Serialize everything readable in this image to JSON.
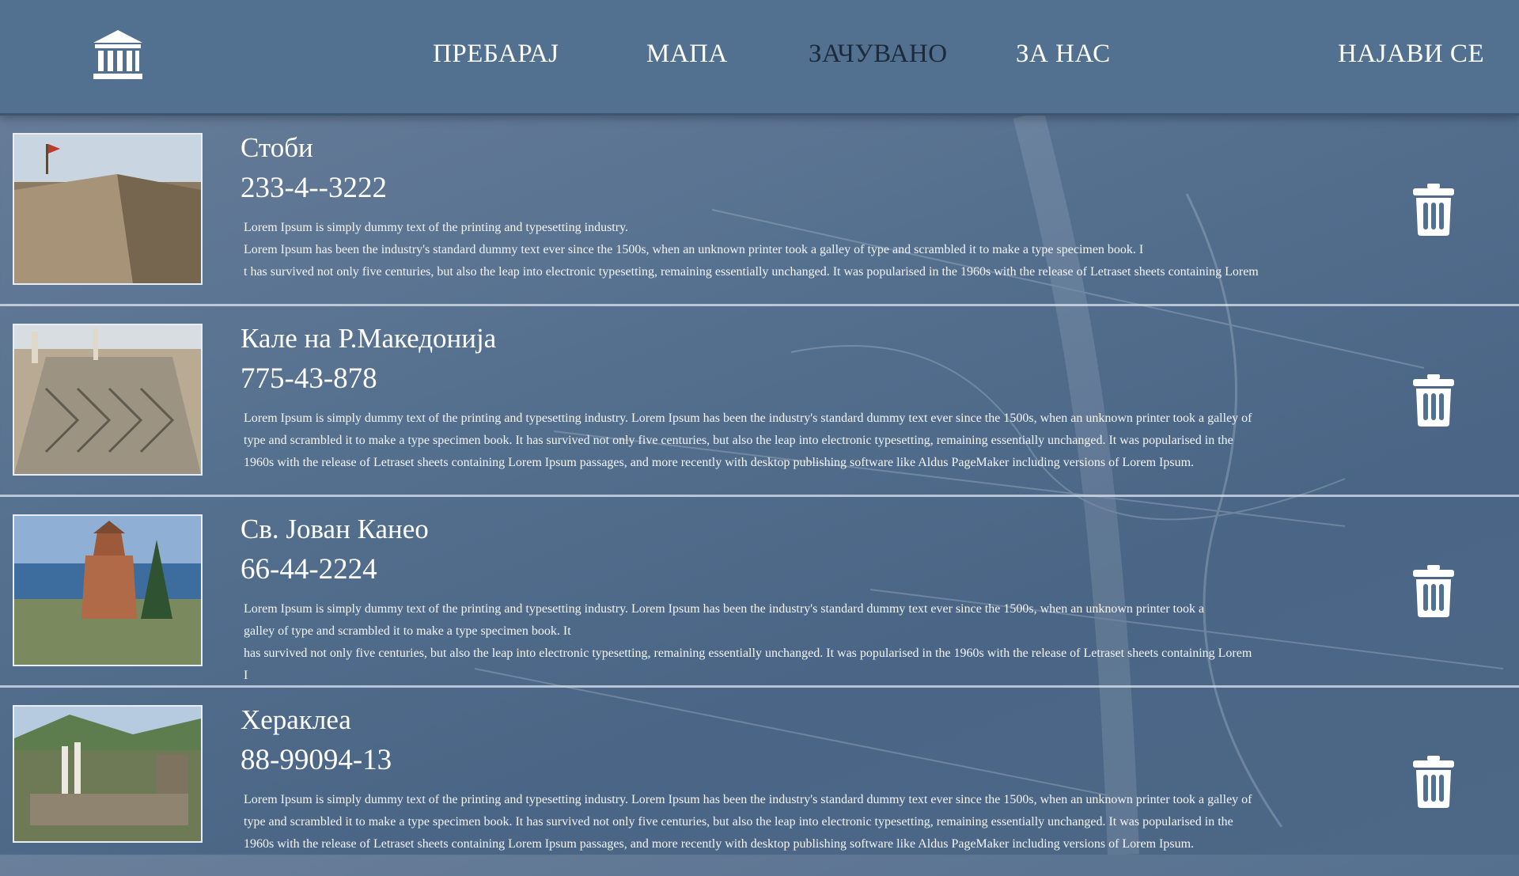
{
  "header": {
    "logo_icon": "museum-building-icon",
    "nav": [
      {
        "label": "ПРЕБАРАЈ",
        "active": false
      },
      {
        "label": "МАПА",
        "active": false
      },
      {
        "label": "ЗАЧУВАНО",
        "active": true
      },
      {
        "label": "ЗА НАС",
        "active": false
      }
    ],
    "login_label": "НАЈАВИ СЕ"
  },
  "saved_items": [
    {
      "title": "Стоби",
      "phone": "233-4--3222",
      "description_lines": [
        "Lorem Ipsum is simply dummy text of the printing and typesetting industry.",
        " Lorem Ipsum has been the industry's standard dummy text ever since the 1500s, when an unknown printer took a galley of type and scrambled it to make a type specimen book. I",
        "t has survived not only five centuries, but also the leap into electronic typesetting, remaining essentially unchanged. It was popularised in the 1960s with the release of Letraset sheets containing Lorem"
      ],
      "image": "fortress-walls-photo",
      "action_icon": "trash-icon"
    },
    {
      "title": "Кале на Р.Македонија",
      "phone": "775-43-878",
      "description_lines": [
        "Lorem Ipsum is simply dummy text of the printing and typesetting industry. Lorem Ipsum has been the industry's standard dummy text ever since the 1500s, when an unknown printer took a galley of",
        "type and scrambled it to make a type specimen book. It has survived not only five centuries, but also the leap into electronic typesetting, remaining essentially unchanged. It was popularised in the",
        "1960s with the release of Letraset sheets containing Lorem Ipsum passages, and more recently with desktop publishing software like Aldus PageMaker including versions of Lorem Ipsum."
      ],
      "image": "mosaic-ruins-photo",
      "action_icon": "trash-icon"
    },
    {
      "title": "Св. Јован Канео",
      "phone": "66-44-2224",
      "description_lines": [
        "Lorem Ipsum is simply dummy text of the printing and typesetting industry. Lorem Ipsum has been the industry's standard dummy text ever since the 1500s, when an unknown printer took a",
        " galley of type and scrambled it to make a type specimen book. It",
        " has survived not only five centuries, but also the leap into electronic typesetting, remaining essentially unchanged. It was popularised in the 1960s with the release of Letraset sheets containing Lorem",
        "I"
      ],
      "image": "lakeside-church-photo",
      "action_icon": "trash-icon"
    },
    {
      "title": "Хераклеа",
      "phone": "88-99094-13",
      "description_lines": [
        "Lorem Ipsum is simply dummy text of the printing and typesetting industry. Lorem Ipsum has been the industry's standard dummy text ever since the 1500s, when an unknown printer took a galley of",
        "type and scrambled it to make a type specimen book. It has survived not only five centuries, but also the leap into electronic typesetting, remaining essentially unchanged. It was popularised in the",
        "1960s with the release of Letraset sheets containing Lorem Ipsum passages, and more recently with desktop publishing software like Aldus PageMaker including versions of Lorem Ipsum."
      ],
      "image": "ancient-columns-photo",
      "action_icon": "trash-icon"
    }
  ]
}
